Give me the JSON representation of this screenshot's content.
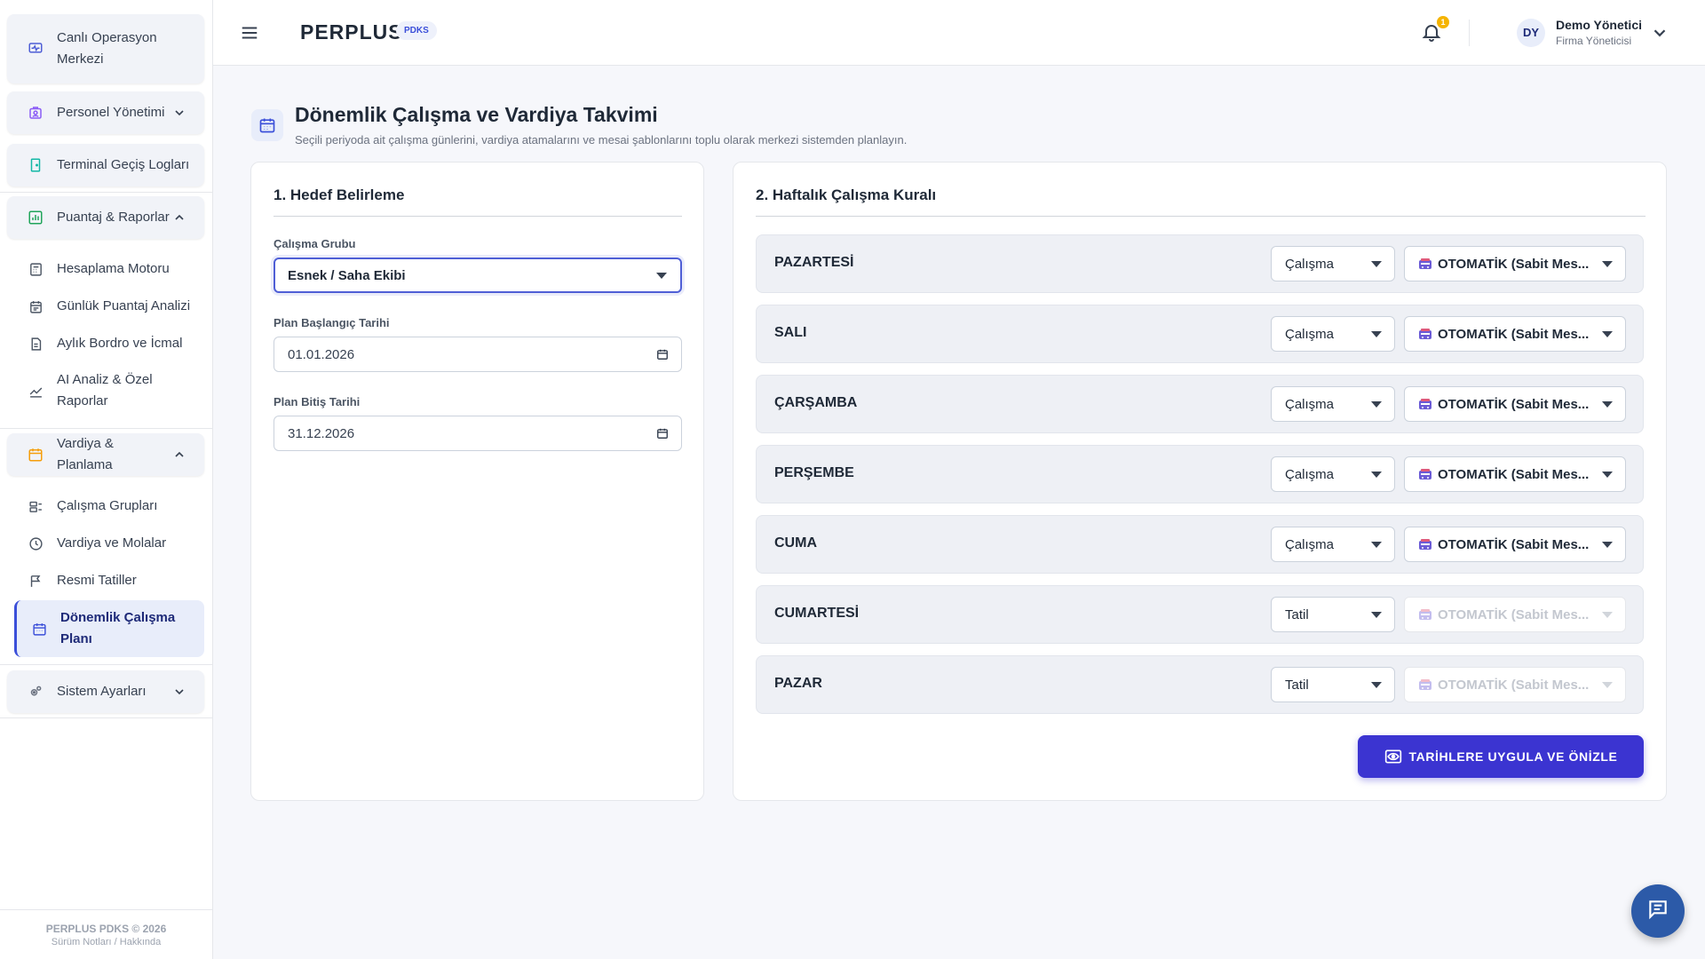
{
  "sidebar": {
    "items": [
      {
        "label": "Canlı Operasyon Merkezi"
      },
      {
        "label": "Personel Yönetimi"
      },
      {
        "label": "Terminal Geçiş Logları"
      },
      {
        "label": "Puantaj & Raporlar"
      },
      {
        "label": "Hesaplama Motoru"
      },
      {
        "label": "Günlük Puantaj Analizi"
      },
      {
        "label": "Aylık Bordro ve İcmal"
      },
      {
        "label": "AI Analiz & Özel Raporlar"
      },
      {
        "label": "Vardiya & Planlama"
      },
      {
        "label": "Çalışma Grupları"
      },
      {
        "label": "Vardiya ve Molalar"
      },
      {
        "label": "Resmi Tatiller"
      },
      {
        "label": "Dönemlik Çalışma Planı"
      },
      {
        "label": "Sistem Ayarları"
      }
    ],
    "footer_title": "PERPLUS PDKS © 2026",
    "footer_links": "Sürüm Notları / Hakkında"
  },
  "header": {
    "brand": "PERPLUS",
    "brand_badge": "PDKS",
    "notification_count": "1",
    "user_initials": "DY",
    "user_name": "Demo Yönetici",
    "user_role": "Firma Yöneticisi"
  },
  "page": {
    "title": "Dönemlik Çalışma ve Vardiya Takvimi",
    "subtitle": "Seçili periyoda ait çalışma günlerini, vardiya atamalarını ve mesai şablonlarını toplu olarak merkezi sistemden planlayın."
  },
  "target": {
    "title": "1. Hedef Belirleme",
    "group_label": "Çalışma Grubu",
    "group_value": "Esnek / Saha Ekibi",
    "start_label": "Plan Başlangıç Tarihi",
    "start_value": "01.01.2026",
    "end_label": "Plan Bitiş Tarihi",
    "end_value": "31.12.2026"
  },
  "weekly": {
    "title": "2. Haftalık Çalışma Kuralı",
    "days": [
      {
        "name": "PAZARTESİ",
        "type": "Çalışma",
        "template": "OTOMATİK (Sabit Mes...",
        "enabled": true
      },
      {
        "name": "SALI",
        "type": "Çalışma",
        "template": "OTOMATİK (Sabit Mes...",
        "enabled": true
      },
      {
        "name": "ÇARŞAMBA",
        "type": "Çalışma",
        "template": "OTOMATİK (Sabit Mes...",
        "enabled": true
      },
      {
        "name": "PERŞEMBE",
        "type": "Çalışma",
        "template": "OTOMATİK (Sabit Mes...",
        "enabled": true
      },
      {
        "name": "CUMA",
        "type": "Çalışma",
        "template": "OTOMATİK (Sabit Mes...",
        "enabled": true
      },
      {
        "name": "CUMARTESİ",
        "type": "Tatil",
        "template": "OTOMATİK (Sabit Mes...",
        "enabled": false
      },
      {
        "name": "PAZAR",
        "type": "Tatil",
        "template": "OTOMATİK (Sabit Mes...",
        "enabled": false
      }
    ],
    "apply_label": "TARİHLERE UYGULA VE ÖNİZLE"
  },
  "colors": {
    "accent": "#3b4fd9",
    "primary_button": "#3b34d1",
    "fab": "#2c5aa8",
    "badge": "#f5b400"
  }
}
